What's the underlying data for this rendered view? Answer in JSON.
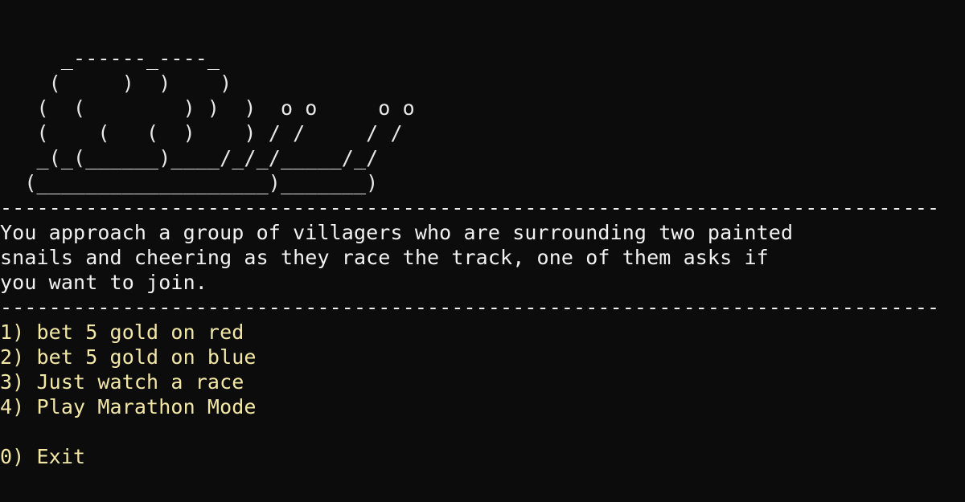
{
  "art": {
    "lines": [
      "     _------_----_",
      "    (     )  )    )",
      "   (  (        ) )  )  o o     o o",
      "   (    (   (  )    ) / /     / /",
      "   _(_(______)____/_/_/_____/_/",
      "  (___________________)_______)"
    ]
  },
  "divider": {
    "top": "----------------------------------------------------------------------------------------------------",
    "bottom": "----------------------------------------------------------------------------------------------------"
  },
  "narration": {
    "lines": [
      "You approach a group of villagers who are surrounding two painted",
      "snails and cheering as they race the track, one of them asks if",
      "you want to join."
    ]
  },
  "menu": {
    "options": [
      "1) bet 5 gold on red",
      "2) bet 5 gold on blue",
      "3) Just watch a race",
      "4) Play Marathon Mode"
    ],
    "exit": "0) Exit"
  },
  "colors": {
    "background": "#0c0c0c",
    "text": "#f2f2f2",
    "menu_text": "#f3e7a6"
  }
}
